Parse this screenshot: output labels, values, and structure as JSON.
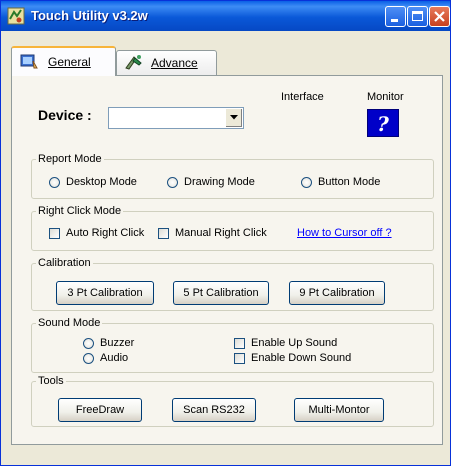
{
  "window": {
    "title": "Touch Utility v3.2w"
  },
  "tabs": {
    "general": {
      "label": "General"
    },
    "advance": {
      "label": "Advance"
    }
  },
  "device": {
    "label": "Device :",
    "value": "",
    "interface_label": "Interface",
    "monitor_label": "Monitor",
    "monitor_button_glyph": "?"
  },
  "report_mode": {
    "title": "Report Mode",
    "options": [
      "Desktop Mode",
      "Drawing Mode",
      "Button Mode"
    ]
  },
  "right_click": {
    "title": "Right Click Mode",
    "auto": "Auto Right Click",
    "manual": "Manual Right Click",
    "link": "How to Cursor off ?"
  },
  "calibration": {
    "title": "Calibration",
    "buttons": [
      "3 Pt Calibration",
      "5 Pt Calibration",
      "9 Pt Calibration"
    ]
  },
  "sound_mode": {
    "title": "Sound Mode",
    "buzzer": "Buzzer",
    "audio": "Audio",
    "enable_up": "Enable Up Sound",
    "enable_down": "Enable Down Sound"
  },
  "tools": {
    "title": "Tools",
    "buttons": [
      "FreeDraw",
      "Scan RS232",
      "Multi-Montor"
    ]
  },
  "colors": {
    "titlebar": "#0a58d8",
    "window_bg": "#ece9d8",
    "link": "#0000ff",
    "monitor_button": "#0000c8"
  }
}
